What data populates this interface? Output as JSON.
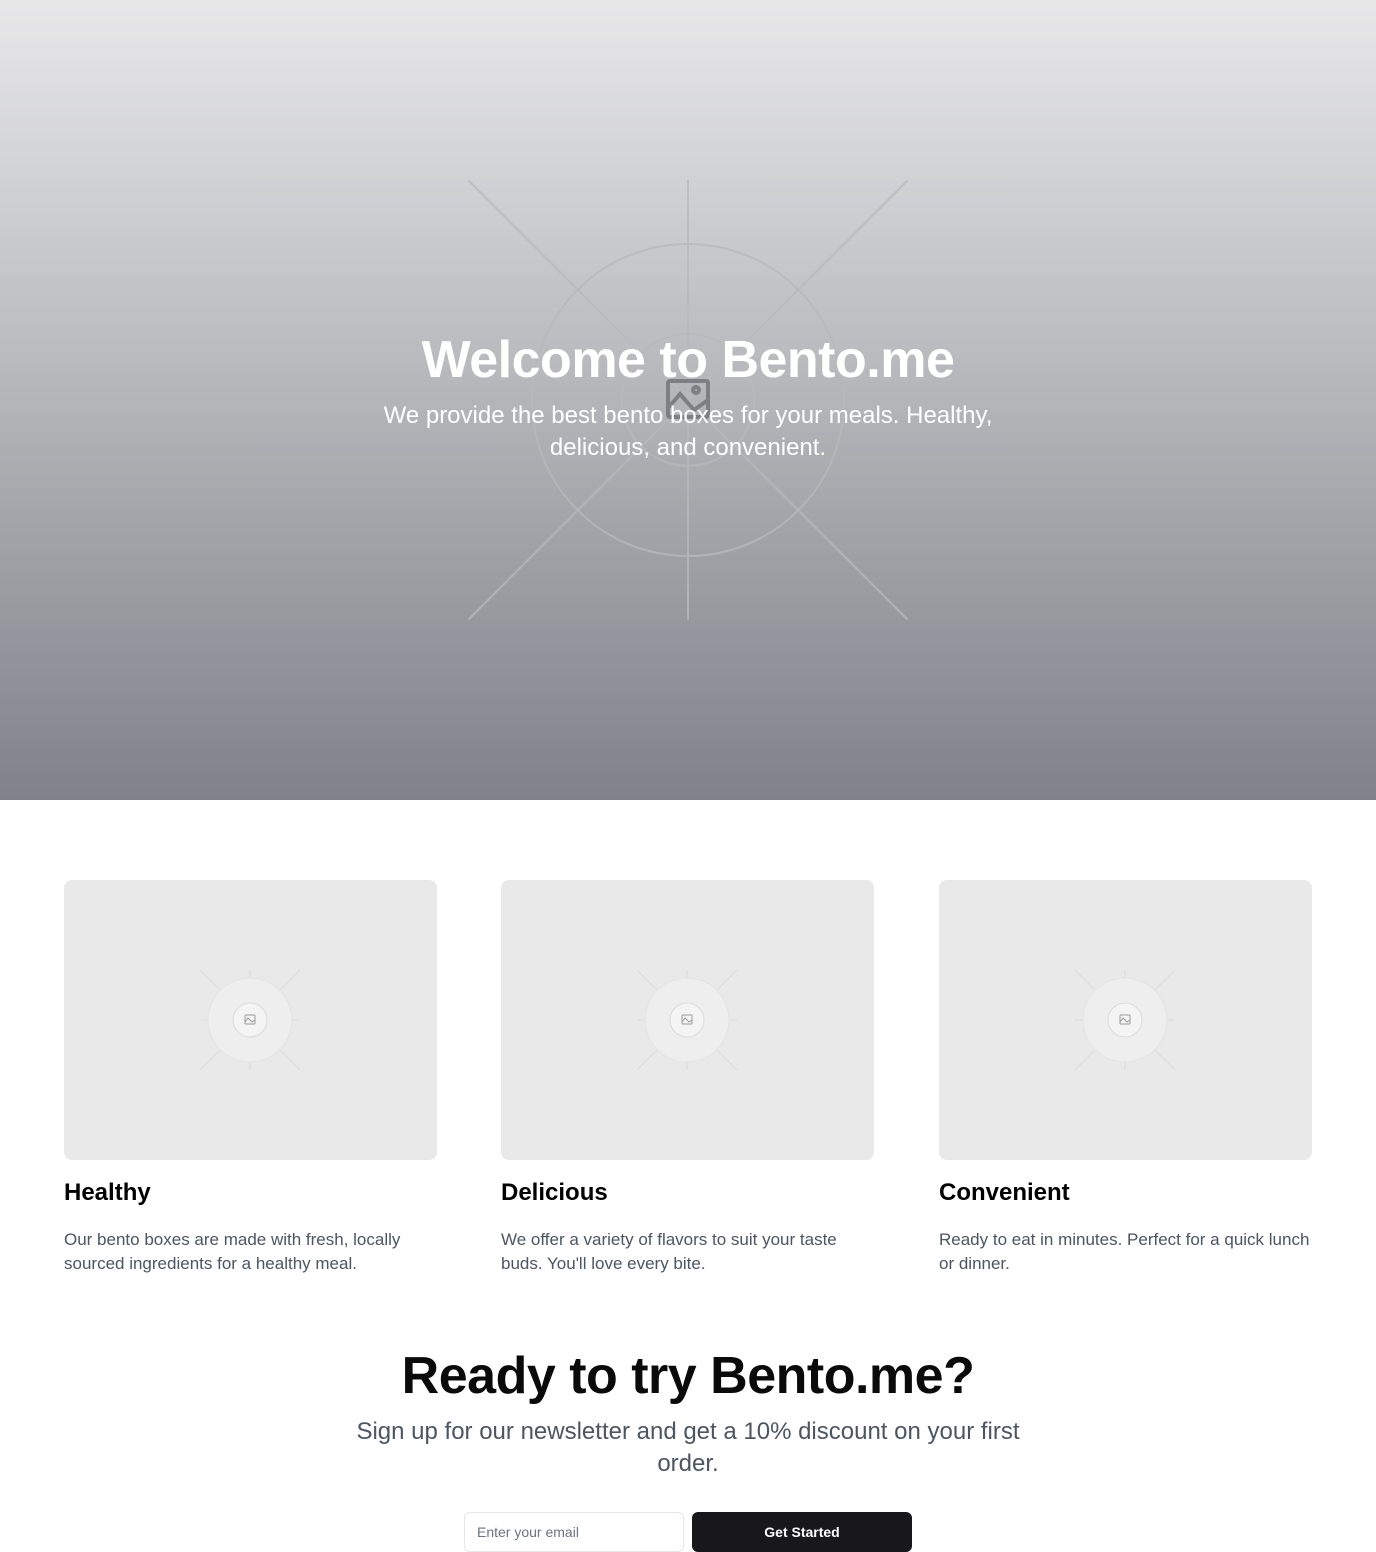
{
  "hero": {
    "title": "Welcome to Bento.me",
    "subtitle": "We provide the best bento boxes for your meals. Healthy, delicious, and convenient.",
    "image_icon": "image-placeholder-icon"
  },
  "features": [
    {
      "title": "Healthy",
      "text": "Our bento boxes are made with fresh, locally sourced ingredients for a healthy meal.",
      "image_icon": "image-placeholder-icon"
    },
    {
      "title": "Delicious",
      "text": "We offer a variety of flavors to suit your taste buds. You'll love every bite.",
      "image_icon": "image-placeholder-icon"
    },
    {
      "title": "Convenient",
      "text": "Ready to eat in minutes. Perfect for a quick lunch or dinner.",
      "image_icon": "image-placeholder-icon"
    }
  ],
  "cta": {
    "title": "Ready to try Bento.me?",
    "subtitle": "Sign up for our newsletter and get a 10% discount on your first order.",
    "email_placeholder": "Enter your email",
    "email_value": "",
    "button_label": "Get Started"
  },
  "colors": {
    "button_bg": "#18181b",
    "muted_text": "#4b5563",
    "placeholder_bg": "#e9e9e9"
  }
}
